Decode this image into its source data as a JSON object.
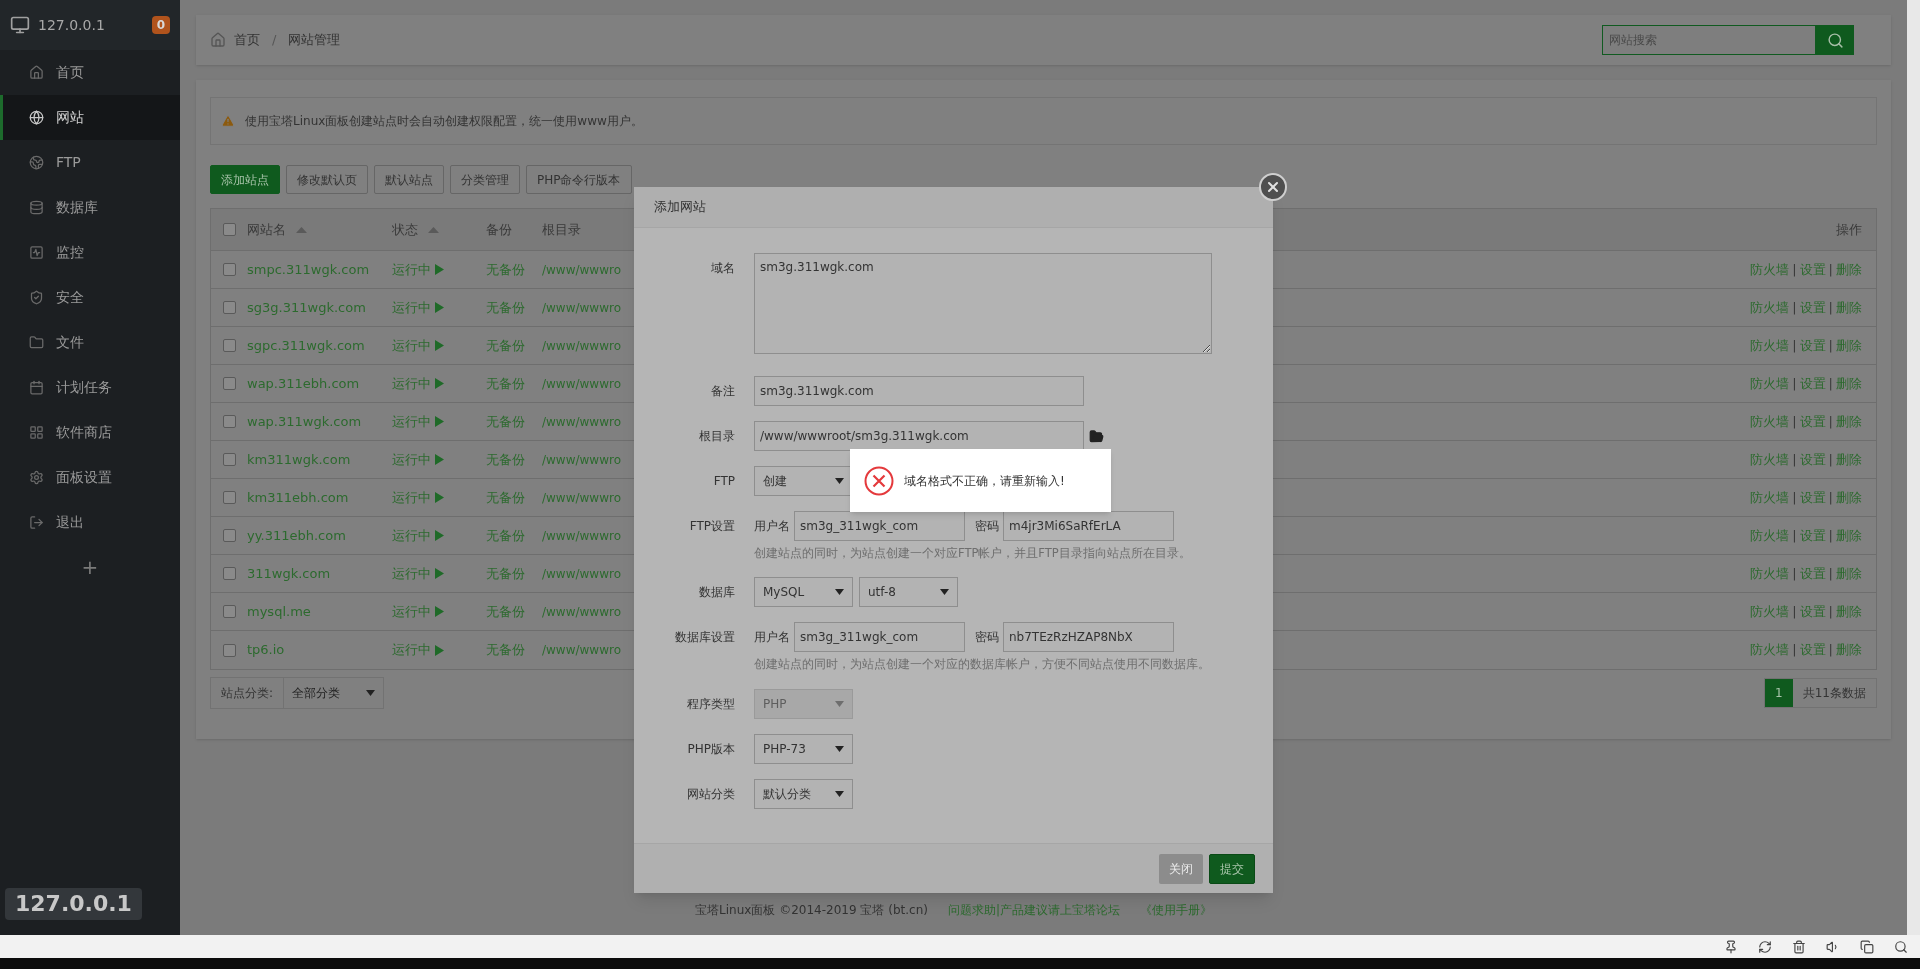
{
  "sidebar": {
    "host": "127.0.0.1",
    "badge": "0",
    "items": [
      {
        "label": "首页",
        "selected": false
      },
      {
        "label": "网站",
        "selected": true
      },
      {
        "label": "FTP",
        "selected": false
      },
      {
        "label": "数据库",
        "selected": false
      },
      {
        "label": "监控",
        "selected": false
      },
      {
        "label": "安全",
        "selected": false
      },
      {
        "label": "文件",
        "selected": false
      },
      {
        "label": "计划任务",
        "selected": false
      },
      {
        "label": "软件商店",
        "selected": false
      },
      {
        "label": "面板设置",
        "selected": false
      },
      {
        "label": "退出",
        "selected": false
      }
    ],
    "add": "+",
    "footer_host": "127.0.0.1"
  },
  "breadcrumb": {
    "items": [
      "首页",
      "网站管理"
    ],
    "separator": "/"
  },
  "search": {
    "placeholder": "网站搜索"
  },
  "notice": "使用宝塔Linux面板创建站点时会自动创建权限配置，统一使用www用户。",
  "toolbar": [
    {
      "label": "添加站点",
      "primary": true
    },
    {
      "label": "修改默认页",
      "primary": false
    },
    {
      "label": "默认站点",
      "primary": false
    },
    {
      "label": "分类管理",
      "primary": false
    },
    {
      "label": "PHP命令行版本",
      "primary": false
    }
  ],
  "table": {
    "all_checked": false,
    "columns": [
      {
        "label": "网站名",
        "sortable": true
      },
      {
        "label": "状态",
        "sortable": true
      },
      {
        "label": "备份",
        "sortable": false
      },
      {
        "label": "根目录",
        "sortable": false
      },
      {
        "label": "操作",
        "sortable": false
      }
    ],
    "action_separator": "|",
    "rows": [
      {
        "checked": false,
        "name": "smpc.311wgk.com",
        "status": "运行中",
        "backup": "无备份",
        "root": "/www/wwwro",
        "actions": [
          "防火墙",
          "设置",
          "删除"
        ]
      },
      {
        "checked": false,
        "name": "sg3g.311wgk.com",
        "status": "运行中",
        "backup": "无备份",
        "root": "/www/wwwro",
        "actions": [
          "防火墙",
          "设置",
          "删除"
        ]
      },
      {
        "checked": false,
        "name": "sgpc.311wgk.com",
        "status": "运行中",
        "backup": "无备份",
        "root": "/www/wwwro",
        "actions": [
          "防火墙",
          "设置",
          "删除"
        ]
      },
      {
        "checked": false,
        "name": "wap.311ebh.com",
        "status": "运行中",
        "backup": "无备份",
        "root": "/www/wwwro",
        "actions": [
          "防火墙",
          "设置",
          "删除"
        ]
      },
      {
        "checked": false,
        "name": "wap.311wgk.com",
        "status": "运行中",
        "backup": "无备份",
        "root": "/www/wwwro",
        "actions": [
          "防火墙",
          "设置",
          "删除"
        ]
      },
      {
        "checked": false,
        "name": "km311wgk.com",
        "status": "运行中",
        "backup": "无备份",
        "root": "/www/wwwro",
        "actions": [
          "防火墙",
          "设置",
          "删除"
        ]
      },
      {
        "checked": false,
        "name": "km311ebh.com",
        "status": "运行中",
        "backup": "无备份",
        "root": "/www/wwwro",
        "actions": [
          "防火墙",
          "设置",
          "删除"
        ]
      },
      {
        "checked": false,
        "name": "yy.311ebh.com",
        "status": "运行中",
        "backup": "无备份",
        "root": "/www/wwwro",
        "actions": [
          "防火墙",
          "设置",
          "删除"
        ]
      },
      {
        "checked": false,
        "name": "311wgk.com",
        "status": "运行中",
        "backup": "无备份",
        "root": "/www/wwwro",
        "actions": [
          "防火墙",
          "设置",
          "删除"
        ]
      },
      {
        "checked": false,
        "name": "mysql.me",
        "status": "运行中",
        "backup": "无备份",
        "root": "/www/wwwro",
        "actions": [
          "防火墙",
          "设置",
          "删除"
        ]
      },
      {
        "checked": false,
        "name": "tp6.io",
        "status": "运行中",
        "backup": "无备份",
        "root": "/www/wwwro",
        "actions": [
          "防火墙",
          "设置",
          "删除"
        ]
      }
    ]
  },
  "category_filter": {
    "label": "站点分类:",
    "value": "全部分类"
  },
  "pagination": {
    "pages": [
      {
        "label": "1",
        "selected": true
      }
    ],
    "total": "共11条数据"
  },
  "dialog": {
    "title": "添加网站",
    "fields": [
      {
        "kind": "textarea",
        "label": "域名",
        "value": "sm3g.311wgk.com"
      },
      {
        "kind": "input",
        "label": "备注",
        "value": "sm3g.311wgk.com"
      },
      {
        "kind": "path",
        "label": "根目录",
        "value": "/www/wwwroot/sm3g.311wgk.com"
      },
      {
        "kind": "select",
        "label": "FTP",
        "selects": [
          {
            "value": "创建",
            "disabled": false
          }
        ]
      },
      {
        "kind": "credentials",
        "label": "FTP设置",
        "user_label": "用户名",
        "user": "sm3g_311wgk_com",
        "pass_label": "密码",
        "pass": "m4jr3Mi6SaRfErLA",
        "note": "创建站点的同时，为站点创建一个对应FTP帐户，并且FTP目录指向站点所在目录。"
      },
      {
        "kind": "select",
        "label": "数据库",
        "selects": [
          {
            "value": "MySQL",
            "disabled": false
          },
          {
            "value": "utf-8",
            "disabled": false
          }
        ]
      },
      {
        "kind": "credentials",
        "label": "数据库设置",
        "user_label": "用户名",
        "user": "sm3g_311wgk_com",
        "pass_label": "密码",
        "pass": "nb7TEzRzHZAP8NbX",
        "note": "创建站点的同时，为站点创建一个对应的数据库帐户，方便不同站点使用不同数据库。"
      },
      {
        "kind": "select",
        "label": "程序类型",
        "selects": [
          {
            "value": "PHP",
            "disabled": true
          }
        ]
      },
      {
        "kind": "select",
        "label": "PHP版本",
        "selects": [
          {
            "value": "PHP-73",
            "disabled": false
          }
        ]
      },
      {
        "kind": "select",
        "label": "网站分类",
        "selects": [
          {
            "value": "默认分类",
            "disabled": false
          }
        ]
      }
    ],
    "buttons": [
      {
        "label": "关闭",
        "primary": false
      },
      {
        "label": "提交",
        "primary": true
      }
    ]
  },
  "toast": {
    "message": "域名格式不正确，请重新输入!"
  },
  "footer": {
    "copyright": "宝塔Linux面板 ©2014-2019 宝塔 (bt.cn)",
    "links": [
      "问题求助|产品建议请上宝塔论坛",
      "《使用手册》"
    ]
  }
}
